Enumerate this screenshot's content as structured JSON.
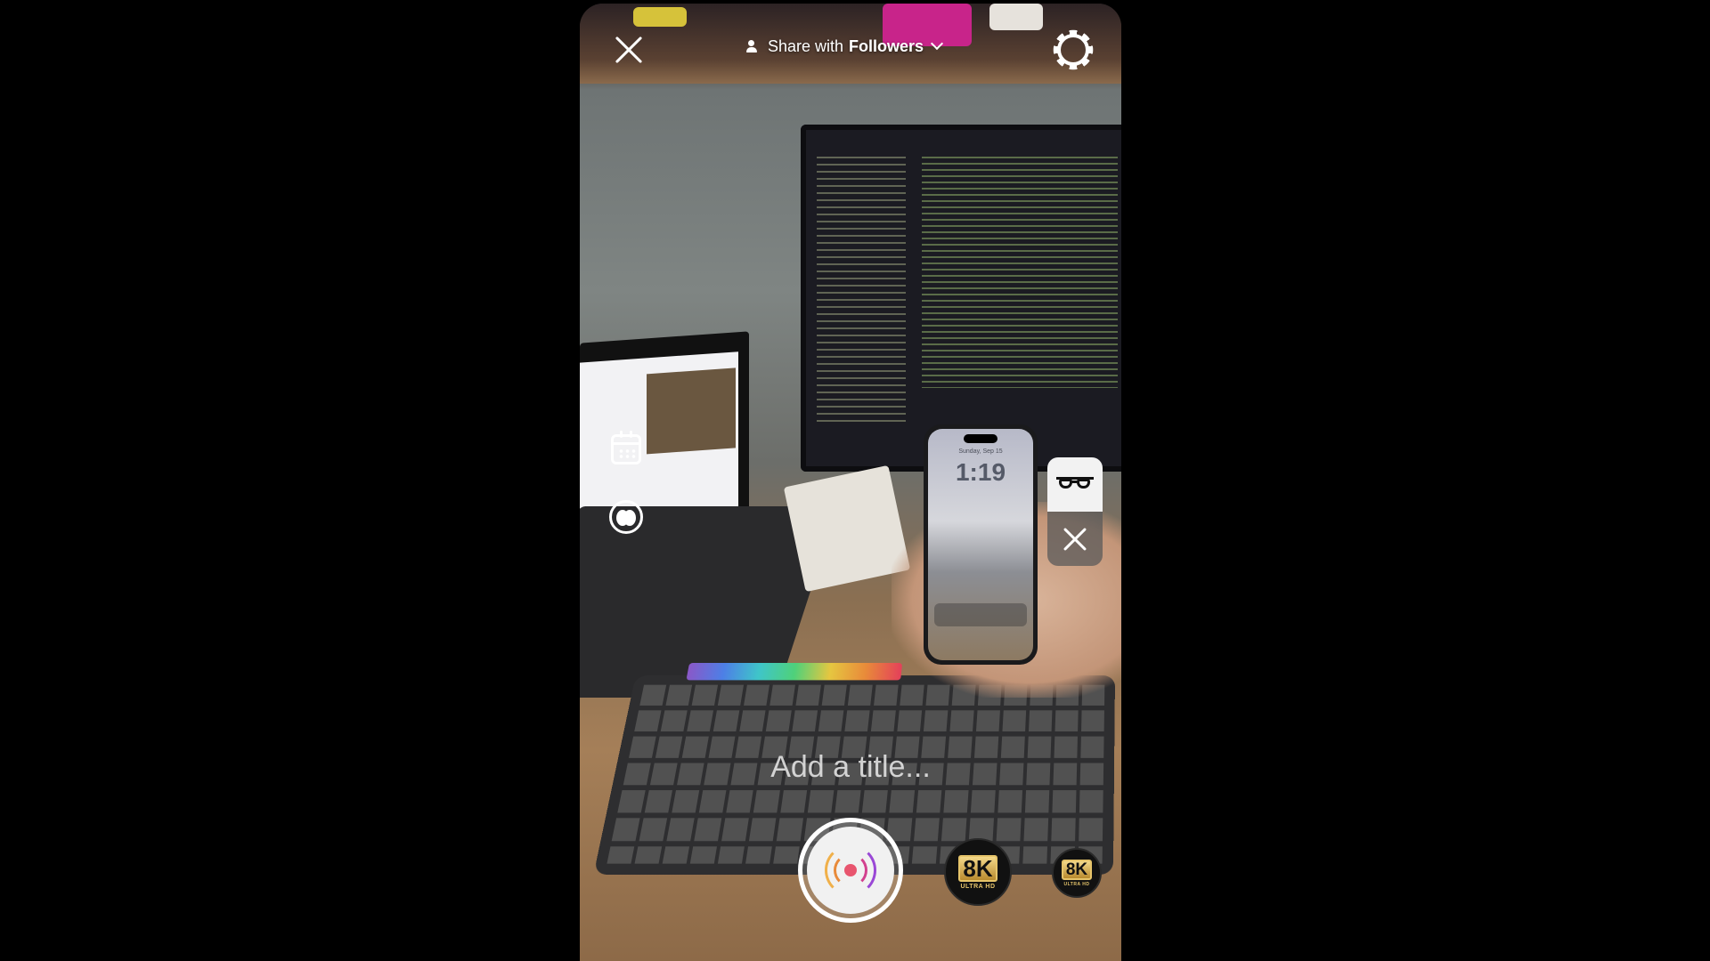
{
  "header": {
    "share_prefix": "Share with",
    "share_audience": "Followers"
  },
  "preview": {
    "held_phone_date": "Sunday, Sep 15",
    "held_phone_time": "1:19"
  },
  "title_input": {
    "placeholder": "Add a title...",
    "value": ""
  },
  "badges": {
    "resolution_large": "8K",
    "resolution_large_sub": "ULTRA HD",
    "resolution_small": "8K",
    "resolution_small_sub": "ULTRA HD"
  },
  "icons": {
    "close": "close-icon",
    "share": "people-icon",
    "settings": "gear-icon",
    "schedule": "calendar-icon",
    "audience": "group-icon",
    "glasses": "glasses-icon",
    "dismiss": "close-icon",
    "go_live": "broadcast-icon"
  },
  "colors": {
    "background": "#000000",
    "ui_foreground": "#ffffff",
    "live_accent": "#e8556e",
    "badge_gold": "#e6c46a"
  }
}
